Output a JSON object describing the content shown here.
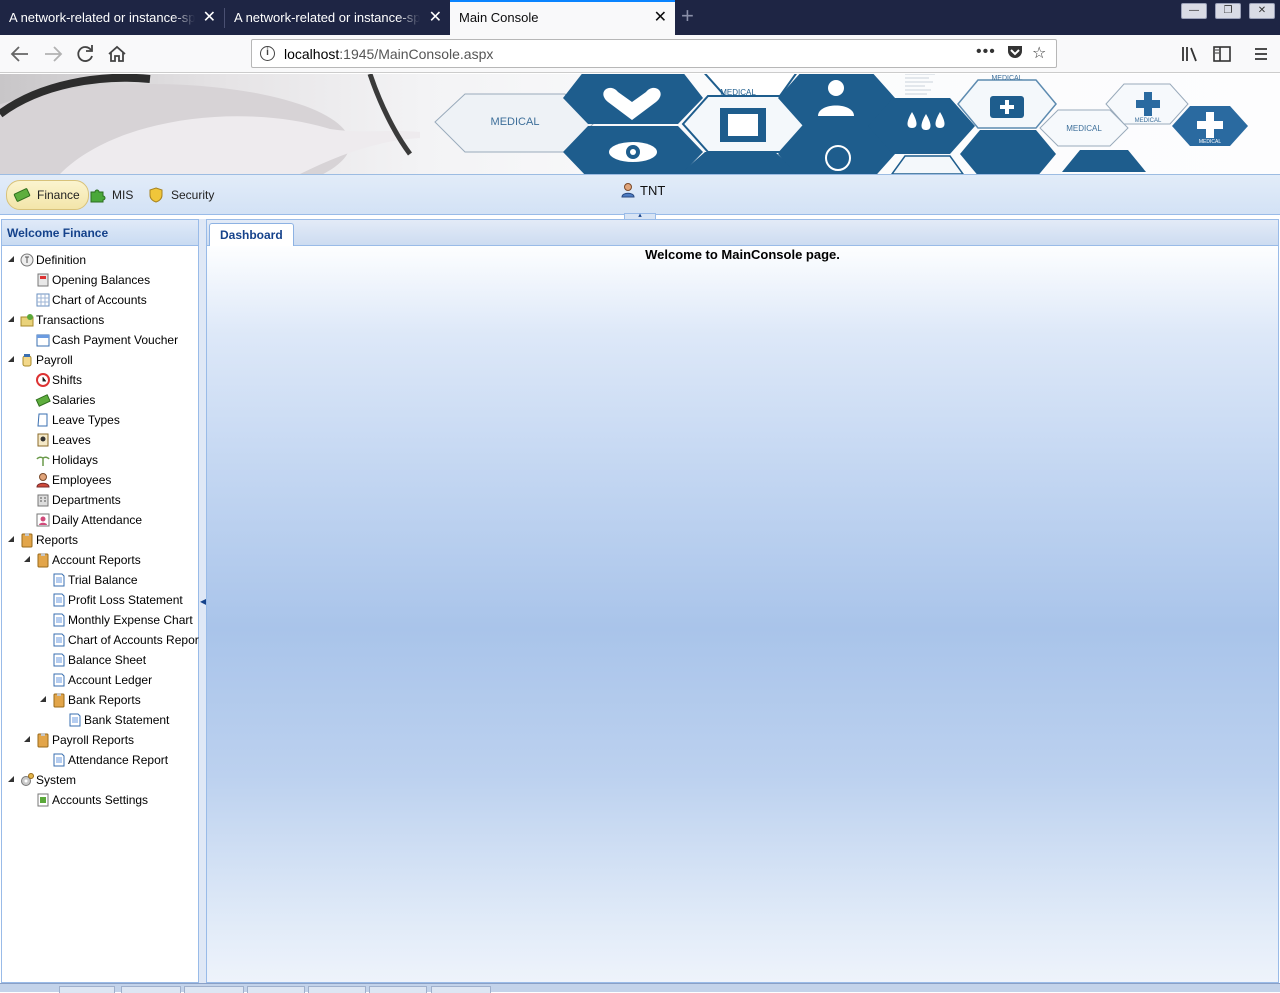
{
  "browser": {
    "tabs": [
      {
        "title": "A network-related or instance-specific error",
        "active": false
      },
      {
        "title": "A network-related or instance-specific error",
        "active": false
      },
      {
        "title": "Main Console",
        "active": true
      }
    ],
    "url_host": "localhost",
    "url_rest": ":1945/MainConsole.aspx"
  },
  "banner": {
    "labels": [
      "MEDICAL",
      "MEDICAL",
      "MEDICAL",
      "MEDICAL",
      "MEDICAL"
    ]
  },
  "toolbar": {
    "buttons": [
      {
        "label": "Finance",
        "pressed": true,
        "icon": "money-icon"
      },
      {
        "label": "MIS",
        "pressed": false,
        "icon": "puzzle-icon"
      },
      {
        "label": "Security",
        "pressed": false,
        "icon": "shield-icon"
      }
    ],
    "user": "TNT"
  },
  "sidebar": {
    "title": "Welcome Finance",
    "items": [
      {
        "label": "Definition",
        "level": 0,
        "expanded": true,
        "icon": "definition-icon"
      },
      {
        "label": "Opening Balances",
        "level": 1,
        "icon": "calculator-icon"
      },
      {
        "label": "Chart of Accounts",
        "level": 1,
        "icon": "grid-icon"
      },
      {
        "label": "Transactions",
        "level": 0,
        "expanded": true,
        "icon": "coins-icon"
      },
      {
        "label": "Cash Payment Voucher",
        "level": 1,
        "icon": "window-icon"
      },
      {
        "label": "Payroll",
        "level": 0,
        "expanded": true,
        "icon": "jar-icon"
      },
      {
        "label": "Shifts",
        "level": 1,
        "icon": "clock-icon"
      },
      {
        "label": "Salaries",
        "level": 1,
        "icon": "money-icon"
      },
      {
        "label": "Leave Types",
        "level": 1,
        "icon": "document-icon"
      },
      {
        "label": "Leaves",
        "level": 1,
        "icon": "person-card-icon"
      },
      {
        "label": "Holidays",
        "level": 1,
        "icon": "palm-icon"
      },
      {
        "label": "Employees",
        "level": 1,
        "icon": "user-icon"
      },
      {
        "label": "Departments",
        "level": 1,
        "icon": "building-icon"
      },
      {
        "label": "Daily Attendance",
        "level": 1,
        "icon": "user-card-icon"
      },
      {
        "label": "Reports",
        "level": 0,
        "expanded": true,
        "icon": "clipboard-folder-icon"
      },
      {
        "label": "Account Reports",
        "level": 1,
        "expanded": true,
        "icon": "clipboard-folder-icon"
      },
      {
        "label": "Trial Balance",
        "level": 2,
        "icon": "report-page-icon"
      },
      {
        "label": "Profit Loss Statement",
        "level": 2,
        "icon": "report-page-icon"
      },
      {
        "label": "Monthly Expense Chart",
        "level": 2,
        "icon": "report-page-icon"
      },
      {
        "label": "Chart of Accounts Report",
        "level": 2,
        "icon": "report-page-icon"
      },
      {
        "label": "Balance Sheet",
        "level": 2,
        "icon": "report-page-icon"
      },
      {
        "label": "Account Ledger",
        "level": 2,
        "icon": "report-page-icon"
      },
      {
        "label": "Bank Reports",
        "level": 2,
        "expanded": true,
        "icon": "clipboard-folder-icon"
      },
      {
        "label": "Bank Statement",
        "level": 3,
        "icon": "report-page-icon"
      },
      {
        "label": "Payroll Reports",
        "level": 1,
        "expanded": true,
        "icon": "clipboard-folder-icon"
      },
      {
        "label": "Attendance Report",
        "level": 2,
        "icon": "report-page-icon"
      },
      {
        "label": "System",
        "level": 0,
        "expanded": true,
        "icon": "gears-icon"
      },
      {
        "label": "Accounts Settings",
        "level": 1,
        "icon": "settings-sheet-icon"
      }
    ]
  },
  "main": {
    "tab": "Dashboard",
    "welcome": "Welcome to MainConsole page."
  },
  "colors": {
    "accent": "#15428b",
    "border": "#99bbe8",
    "banner_blue": "#2e6b9e"
  }
}
